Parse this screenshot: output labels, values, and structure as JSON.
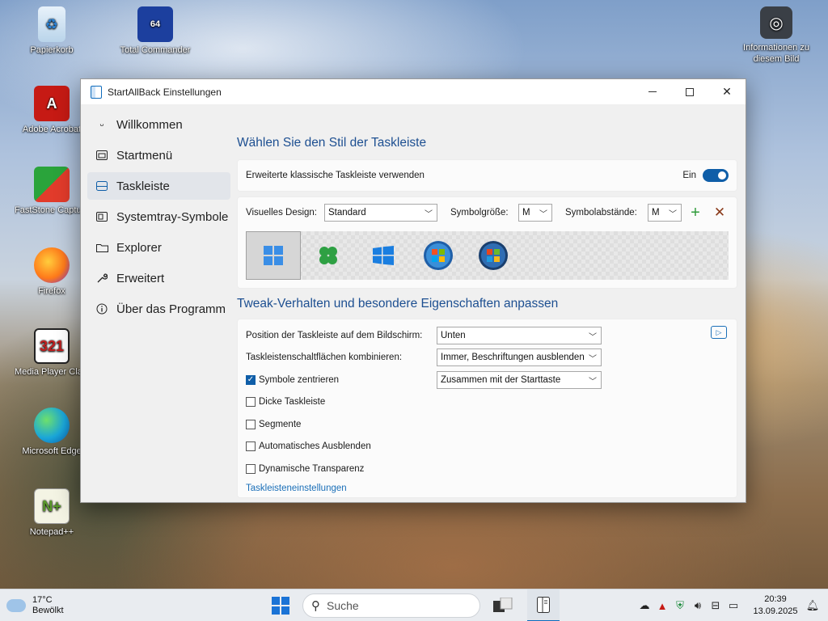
{
  "desktop": {
    "icons": [
      {
        "label": "Papierkorb"
      },
      {
        "label": "Total Commander"
      },
      {
        "label": "Informationen zu diesem Bild"
      },
      {
        "label": "Adobe Acrobat"
      },
      {
        "label": "FastStone Capture"
      },
      {
        "label": "Firefox"
      },
      {
        "label": "Media Player Classic"
      },
      {
        "label": "Microsoft Edge"
      },
      {
        "label": "Notepad++"
      }
    ]
  },
  "window": {
    "title": "StartAllBack Einstellungen",
    "sidebar": {
      "items": [
        {
          "label": "Willkommen",
          "icon": "smile-icon"
        },
        {
          "label": "Startmenü",
          "icon": "startmenu-icon"
        },
        {
          "label": "Taskleiste",
          "icon": "taskbar-icon",
          "active": true
        },
        {
          "label": "Systemtray-Symbole",
          "icon": "systray-icon"
        },
        {
          "label": "Explorer",
          "icon": "folder-icon"
        },
        {
          "label": "Erweitert",
          "icon": "wrench-icon"
        },
        {
          "label": "Über das Programm",
          "icon": "info-icon"
        }
      ]
    },
    "main": {
      "heading_style": "Wählen Sie den Stil der Taskleiste",
      "classic_toggle": {
        "label": "Erweiterte klassische Taskleiste verwenden",
        "state_label": "Ein",
        "on": true
      },
      "design": {
        "visual_label": "Visuelles Design:",
        "visual_value": "Standard",
        "size_label": "Symbolgröße:",
        "size_value": "M",
        "spacing_label": "Symbolabstände:",
        "spacing_value": "M"
      },
      "style_options": [
        "windows11-style",
        "clover-style",
        "windows10-style",
        "windows7-style",
        "vista-style"
      ],
      "heading_tweak": "Tweak-Verhalten und besondere Eigenschaften anpassen",
      "tweaks": {
        "position_label": "Position der Taskleiste auf dem Bildschirm:",
        "position_value": "Unten",
        "combine_label": "Taskleistenschaltflächen kombinieren:",
        "combine_value": "Immer, Beschriftungen ausblenden",
        "center_label": "Symbole zentrieren",
        "center_checked": true,
        "center_value": "Zusammen mit der Starttaste",
        "thick_label": "Dicke Taskleiste",
        "segments_label": "Segmente",
        "autohide_label": "Automatisches Ausblenden",
        "transparency_label": "Dynamische Transparenz",
        "settings_link": "Taskleisteneinstellungen"
      }
    }
  },
  "taskbar": {
    "weather_temp": "17°C",
    "weather_desc": "Bewölkt",
    "search_placeholder": "Suche",
    "time": "20:39",
    "date": "13.09.2025"
  },
  "colors": {
    "accent": "#0f5ea8",
    "heading": "#1d4f91",
    "link": "#1a6fb8"
  }
}
